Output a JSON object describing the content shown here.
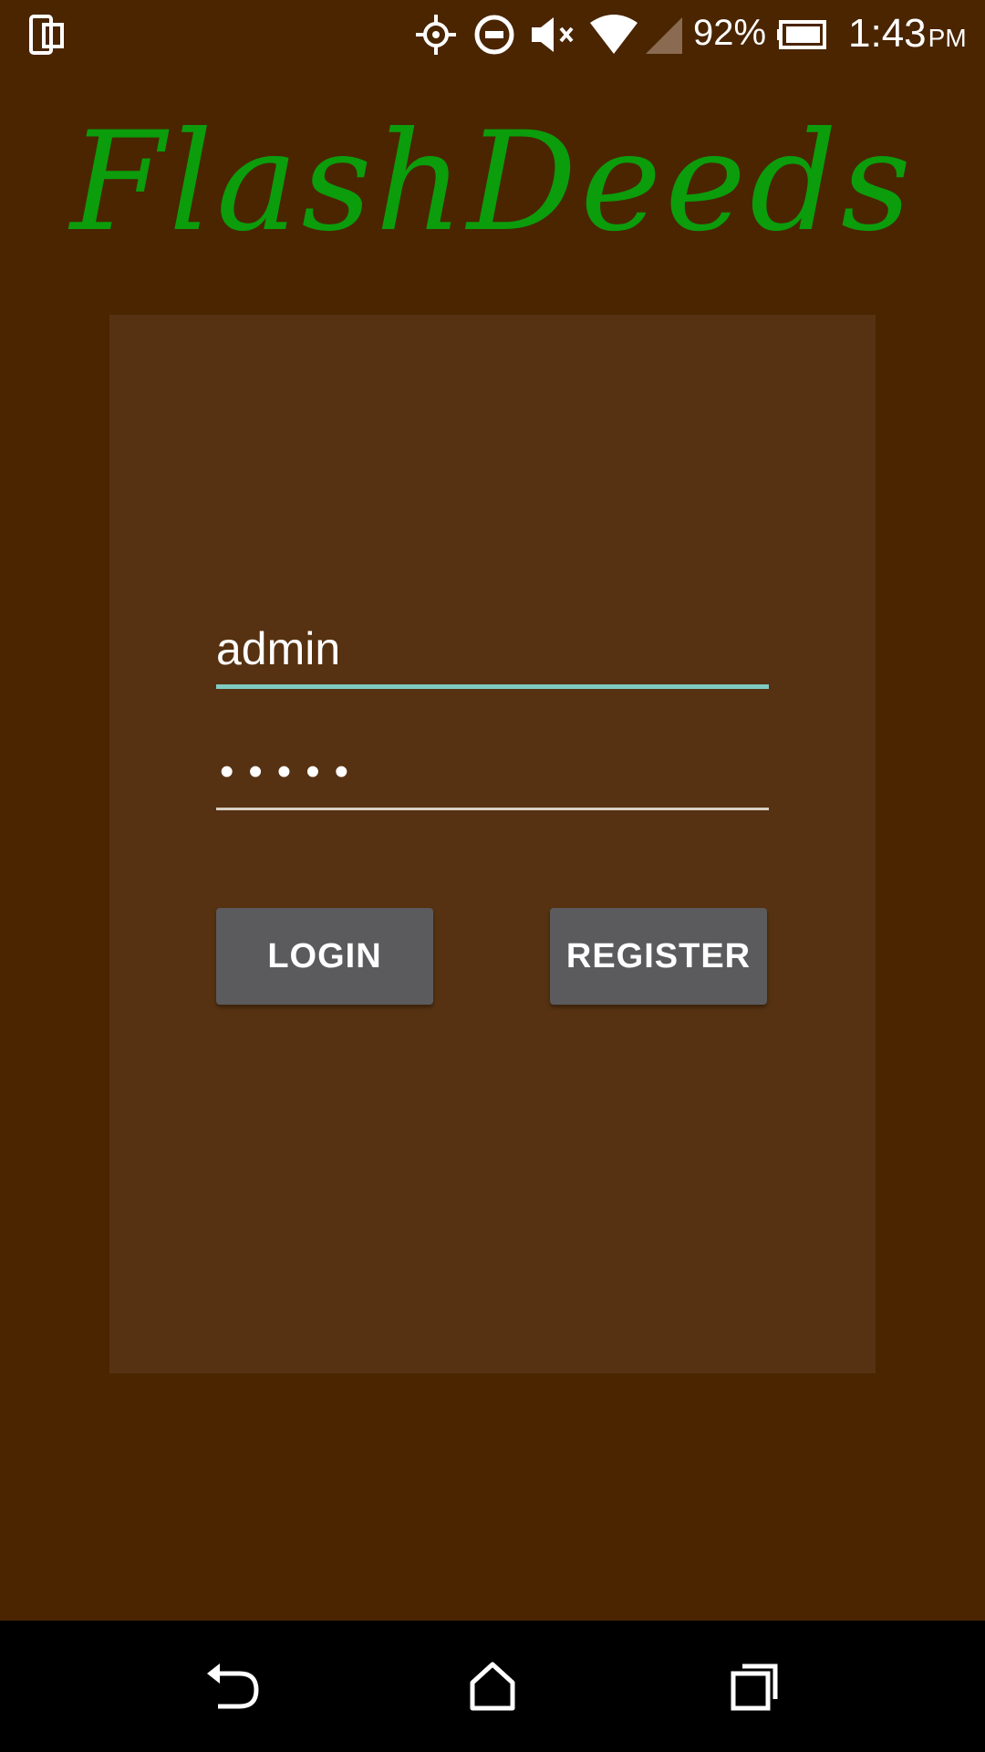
{
  "status_bar": {
    "icons": [
      "phone-icon",
      "gps-icon",
      "do-not-disturb-icon",
      "mute-icon",
      "wifi-icon",
      "signal-icon",
      "battery-icon"
    ],
    "battery": "92%",
    "time": "1:43",
    "ampm": "PM"
  },
  "app": {
    "title": "FlashDeeds",
    "title_color": "#0b9d0b",
    "background": "#4a2500",
    "card_background": "#563212"
  },
  "login_form": {
    "username": "admin",
    "password_mask": "•••••",
    "login_label": "LOGIN",
    "register_label": "REGISTER",
    "focused_underline_color": "#80cbc4",
    "button_color": "#5b5b5d"
  },
  "nav_bar": {
    "buttons": [
      "back-icon",
      "home-icon",
      "recents-icon"
    ]
  }
}
